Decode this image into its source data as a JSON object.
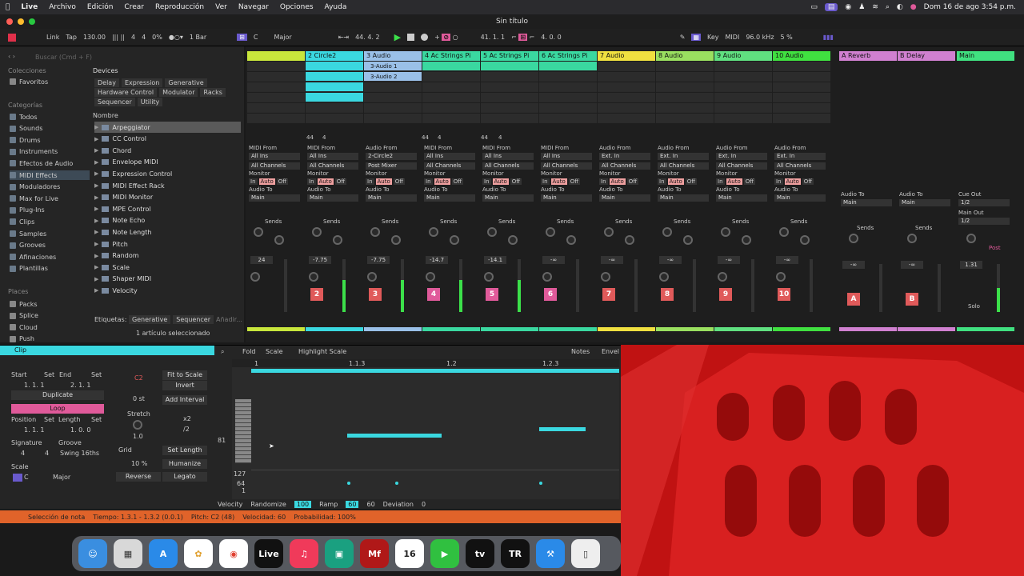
{
  "menubar": {
    "apple": "",
    "items": [
      "Live",
      "Archivo",
      "Edición",
      "Crear",
      "Reproducción",
      "Ver",
      "Navegar",
      "Opciones",
      "Ayuda"
    ],
    "datetime": "Dom 16 de ago  3:54 p.m."
  },
  "title": "Sin título",
  "transport": {
    "link": "Link",
    "tap": "Tap",
    "bpm": "130.00",
    "sig_num": "4",
    "sig_den": "4",
    "pct": "0%",
    "bar": "1 Bar",
    "key": "C",
    "scale": "Major",
    "pos": "44.  4.  2",
    "loop_start": "41.  1.  1",
    "loop_len": "4.  0.  0",
    "key_map": "Key",
    "midi": "MIDI",
    "rate": "96.0 kHz",
    "cpu": "5 %"
  },
  "browser": {
    "search": "Buscar (Cmd + F)",
    "colecciones": "Colecciones",
    "favoritos": "Favoritos",
    "categorias": "Categorías",
    "cats": [
      "Todos",
      "Sounds",
      "Drums",
      "Instruments",
      "Efectos de Audio",
      "MIDI Effects",
      "Moduladores",
      "Max for Live",
      "Plug-Ins",
      "Clips",
      "Samples",
      "Grooves",
      "Afinaciones",
      "Plantillas"
    ],
    "places": "Places",
    "places_items": [
      "Packs",
      "Splice",
      "Cloud",
      "Push"
    ],
    "devices": "Devices",
    "tags_row1": [
      "Delay",
      "Expression",
      "Generative"
    ],
    "tags_row2": [
      "Hardware Control",
      "Modulator",
      "Racks"
    ],
    "tags_row3": [
      "Sequencer",
      "Utility"
    ],
    "nombre": "Nombre",
    "list": [
      "Arpeggiator",
      "CC Control",
      "Chord",
      "Envelope MIDI",
      "Expression Control",
      "MIDI Effect Rack",
      "MIDI Monitor",
      "MPE Control",
      "Note Echo",
      "Note Length",
      "Pitch",
      "Random",
      "Scale",
      "Shaper MIDI",
      "Velocity"
    ],
    "etiquetas": "Etiquetas:",
    "etiq_tags": [
      "Generative",
      "Sequencer",
      "Añadir..."
    ],
    "selected": "1 artículo seleccionado"
  },
  "tracks": [
    {
      "name": "",
      "color": "#c8e63c"
    },
    {
      "name": "2 Circle2",
      "color": "#3ad8e0"
    },
    {
      "name": "3 Audio",
      "color": "#9ac0e8"
    },
    {
      "name": "4 Ac Strings Pi",
      "color": "#3ad8a0"
    },
    {
      "name": "5 Ac Strings Pi",
      "color": "#3ad8a0"
    },
    {
      "name": "6 Ac Strings Pi",
      "color": "#3ad8a0"
    },
    {
      "name": "7 Audio",
      "color": "#f0e040"
    },
    {
      "name": "8 Audio",
      "color": "#9ae060"
    },
    {
      "name": "9 Audio",
      "color": "#60e080"
    },
    {
      "name": "10 Audio",
      "color": "#40e040"
    }
  ],
  "returns": [
    {
      "name": "A Reverb",
      "color": "#d080d0"
    },
    {
      "name": "B Delay",
      "color": "#d080d0"
    },
    {
      "name": "Main",
      "color": "#40e080"
    }
  ],
  "clips": {
    "audio1": "3-Audio 1",
    "audio2": "3-Audio 2"
  },
  "mixer": {
    "sends": "Sends",
    "midi_from": "MIDI From",
    "audio_from": "Audio From",
    "audio_to": "Audio To",
    "monitor": "Monitor",
    "in": "In",
    "auto": "Auto",
    "off": "Off",
    "main": "Main",
    "all_ins": "All Ins",
    "all_channels": "All Channels",
    "ext_in": "Ext. In",
    "post_mixer": "Post Mixer",
    "circle2": "2-Circle2",
    "cue_out": "Cue Out",
    "main_out": "Main Out",
    "cue_val": "1/2",
    "main_val": "1/2",
    "post": "Post",
    "solo": "Solo",
    "vols": [
      "24",
      "-7.75",
      "-7.75",
      "-14.7",
      "-14.1",
      "-∞",
      "-∞",
      "-∞",
      "-∞",
      "-∞"
    ],
    "nums": [
      "",
      "2",
      "3",
      "4",
      "5",
      "6",
      "7",
      "8",
      "9",
      "10"
    ],
    "rvol": [
      "-∞",
      "-∞",
      "1.31"
    ],
    "rnum": [
      "A",
      "B",
      ""
    ],
    "counts": [
      "44",
      "4",
      "44",
      "4",
      "44",
      "4"
    ]
  },
  "clip": {
    "title": "Clip",
    "start": "Start",
    "end": "End",
    "set": "Set",
    "start_val": "1.  1.  1",
    "end_val": "2.  1.  1",
    "duplicate": "Duplicate",
    "loop": "Loop",
    "position": "Position",
    "length": "Length",
    "pos_val": "1.  1.  1",
    "len_val": "1.  0.  0",
    "signature": "Signature",
    "groove": "Groove",
    "sig_num": "4",
    "sig_den": "4",
    "swing": "Swing 16ths",
    "scale": "Scale",
    "scale_key": "C",
    "scale_name": "Major",
    "note": "C2",
    "fit": "Fit to Scale",
    "invert": "Invert",
    "st": "0 st",
    "add_interval": "Add Interval",
    "stretch": "Stretch",
    "x2": "x2",
    "div2": "/2",
    "stretch_val": "1.0",
    "grid": "Grid",
    "set_length": "Set Length",
    "pct": "10 %",
    "humanize": "Humanize",
    "reverse": "Reverse",
    "legato": "Legato",
    "fold": "Fold",
    "scale_btn": "Scale",
    "highlight": "Highlight Scale",
    "notes": "Notes",
    "envel": "Envel",
    "ruler": [
      "1",
      "1.1.3",
      "1.2",
      "1.2.3"
    ],
    "row81": "81",
    "v127": "127",
    "v64": "64",
    "v1": "1",
    "velocity": "Velocity",
    "randomize": "Randomize",
    "rand_val": "100",
    "ramp": "Ramp",
    "ramp_val": "60",
    "ramp_val2": "60",
    "deviation": "Deviation",
    "dev_val": "0"
  },
  "status": {
    "sel": "Selección de nota",
    "time": "Tiempo: 1.3.1 - 1.3.2 (0.0.1)",
    "pitch": "Pitch: C2 (48)",
    "vel": "Velocidad: 60",
    "prob": "Probabilidad: 100%"
  },
  "dock": [
    "Finder",
    "Launchpad",
    "App Store",
    "Photos",
    "Chrome",
    "Live",
    "Music",
    "Slack",
    "Mf",
    "Calendar",
    "FaceTime",
    "Apple TV",
    "TR",
    "Xcode",
    "Mic"
  ],
  "dock_cal": "16",
  "dock_live": "Live"
}
